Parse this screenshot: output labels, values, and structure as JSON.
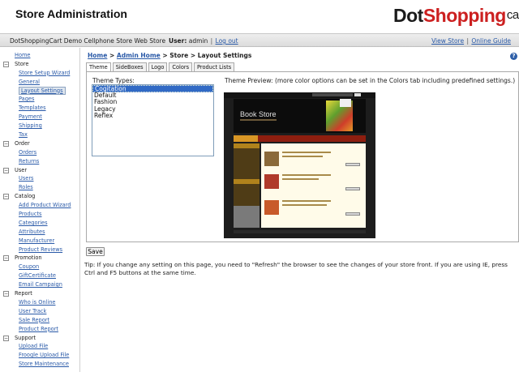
{
  "header": {
    "title": "Store Administration",
    "logo_dot": "Dot",
    "logo_shopping": "Shopping",
    "logo_cart": "cart"
  },
  "subheader": {
    "store_name": "DotShoppingCart Demo Cellphone Store Web Store",
    "user_label": "User:",
    "user_name": "admin",
    "logout": "Log out",
    "view_store": "View Store",
    "online_guide": "Online Guide"
  },
  "sidebar": {
    "home": "Home",
    "sections": [
      {
        "label": "Store",
        "items": [
          "Store Setup Wizard",
          "General",
          "Layout Settings",
          "Pages",
          "Templates",
          "Payment",
          "Shipping",
          "Tax"
        ]
      },
      {
        "label": "Order",
        "items": [
          "Orders",
          "Returns"
        ]
      },
      {
        "label": "User",
        "items": [
          "Users",
          "Roles"
        ]
      },
      {
        "label": "Catalog",
        "items": [
          "Add Product Wizard",
          "Products",
          "Categories",
          "Attributes",
          "Manufacturer",
          "Product Reviews"
        ]
      },
      {
        "label": "Promotion",
        "items": [
          "Coupon",
          "GiftCertificate",
          "Email Campaign"
        ]
      },
      {
        "label": "Report",
        "items": [
          "Who is Online",
          "User Track",
          "Sale Report",
          "Product Report"
        ]
      },
      {
        "label": "Support",
        "items": [
          "Upload File",
          "Froogle Upload File",
          "Store Maintenance"
        ]
      }
    ],
    "selected": "Layout Settings"
  },
  "breadcrumb": {
    "home": "Home",
    "admin_home": "Admin Home",
    "sep": ">",
    "store": "Store",
    "current": "Layout Settings"
  },
  "help_icon": "?",
  "tabs": [
    "Theme",
    "SideBoxes",
    "Logo",
    "Colors",
    "Product Lists"
  ],
  "active_tab": "Theme",
  "theme": {
    "types_label": "Theme Types:",
    "options": [
      "Cogitation",
      "Default",
      "Fashion",
      "Legacy",
      "Reflex"
    ],
    "selected": "Cogitation",
    "preview_label": "Theme Preview: (more color options can be set in the Colors tab including predefined settings.)",
    "preview_store_title": "Book Store"
  },
  "save_label": "Save",
  "tip": "Tip: If you change any setting on this page, you need to \"Refresh\" the browser to see the changes of your store front. If you are using IE, press Ctrl and F5 buttons at the same time.",
  "colors": {
    "link": "#2a5aa8",
    "selection": "#316ac5",
    "logo_red": "#cc2020"
  }
}
